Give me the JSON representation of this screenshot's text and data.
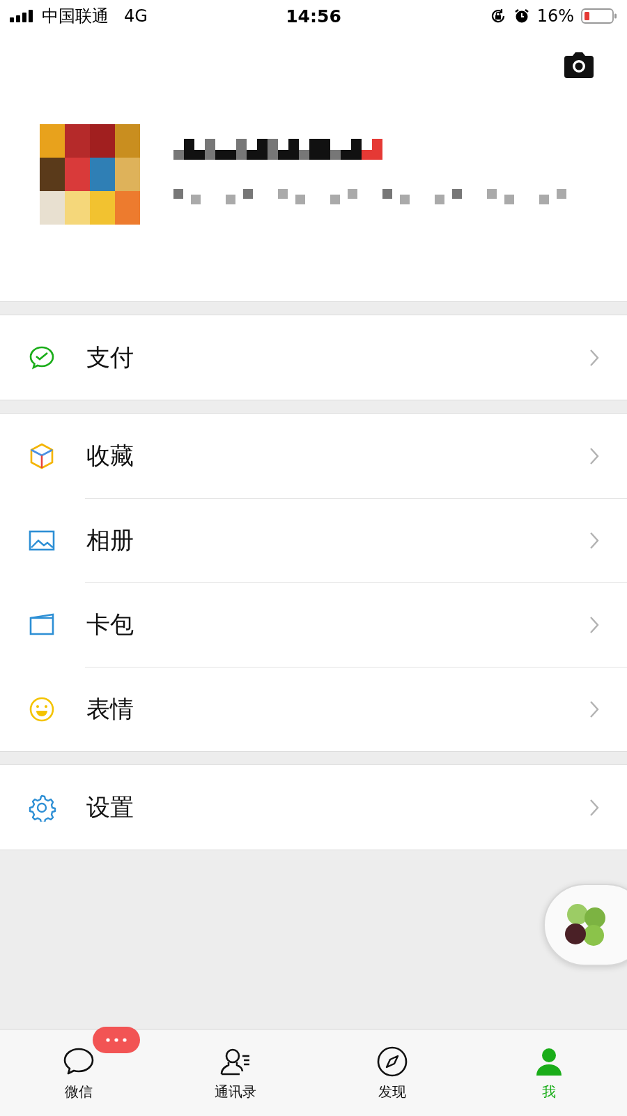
{
  "status_bar": {
    "carrier": "中国联通",
    "network": "4G",
    "time": "14:56",
    "battery_percent": "16%"
  },
  "menu_groups": [
    {
      "items": [
        {
          "kind": "pay",
          "label": "支付"
        }
      ]
    },
    {
      "items": [
        {
          "kind": "favorites",
          "label": "收藏"
        },
        {
          "kind": "album",
          "label": "相册"
        },
        {
          "kind": "cards",
          "label": "卡包"
        },
        {
          "kind": "stickers",
          "label": "表情"
        }
      ]
    },
    {
      "items": [
        {
          "kind": "settings",
          "label": "设置"
        }
      ]
    }
  ],
  "tab_bar": [
    {
      "kind": "chat",
      "label": "微信",
      "badge": true,
      "selected": false
    },
    {
      "kind": "contacts",
      "label": "通讯录",
      "badge": false,
      "selected": false
    },
    {
      "kind": "discover",
      "label": "发现",
      "badge": false,
      "selected": false
    },
    {
      "kind": "me",
      "label": "我",
      "badge": false,
      "selected": true
    }
  ]
}
